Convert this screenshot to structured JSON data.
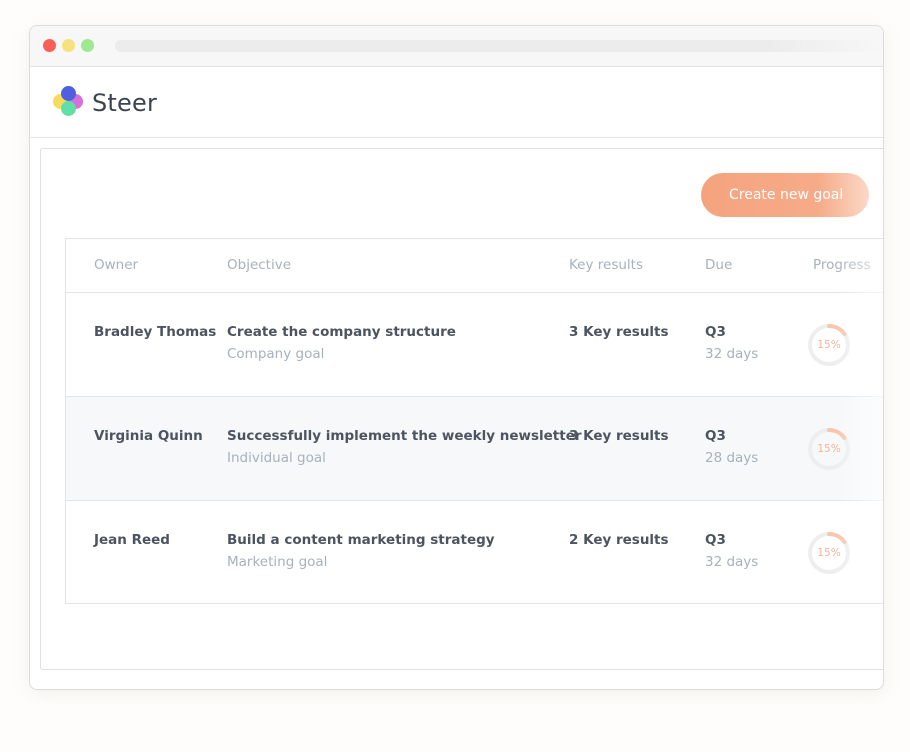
{
  "app": {
    "name": "Steer"
  },
  "toolbar": {
    "create_label": "Create new goal"
  },
  "table": {
    "headers": [
      "Owner",
      "Objective",
      "Key results",
      "Due",
      "Progress"
    ],
    "rows": [
      {
        "owner": "Bradley Thomas",
        "objective": "Create the company structure",
        "type": "Company goal",
        "key_results": "3 Key results",
        "due": "Q3",
        "days": "32 days",
        "progress": "15%",
        "progress_value": 0.15
      },
      {
        "owner": "Virginia Quinn",
        "objective": "Successfully implement the weekly newsletter",
        "type": "Individual goal",
        "key_results": "3 Key results",
        "due": "Q3",
        "days": "28 days",
        "progress": "15%",
        "progress_value": 0.15
      },
      {
        "owner": "Jean Reed",
        "objective": "Build a content marketing strategy",
        "type": "Marketing goal",
        "key_results": "2 Key results",
        "due": "Q3",
        "days": "32 days",
        "progress": "15%",
        "progress_value": 0.15
      }
    ]
  },
  "colors": {
    "accent": "#f5a37f",
    "progress_track": "#eeeeee",
    "progress_fill": "#f8c6ae"
  }
}
